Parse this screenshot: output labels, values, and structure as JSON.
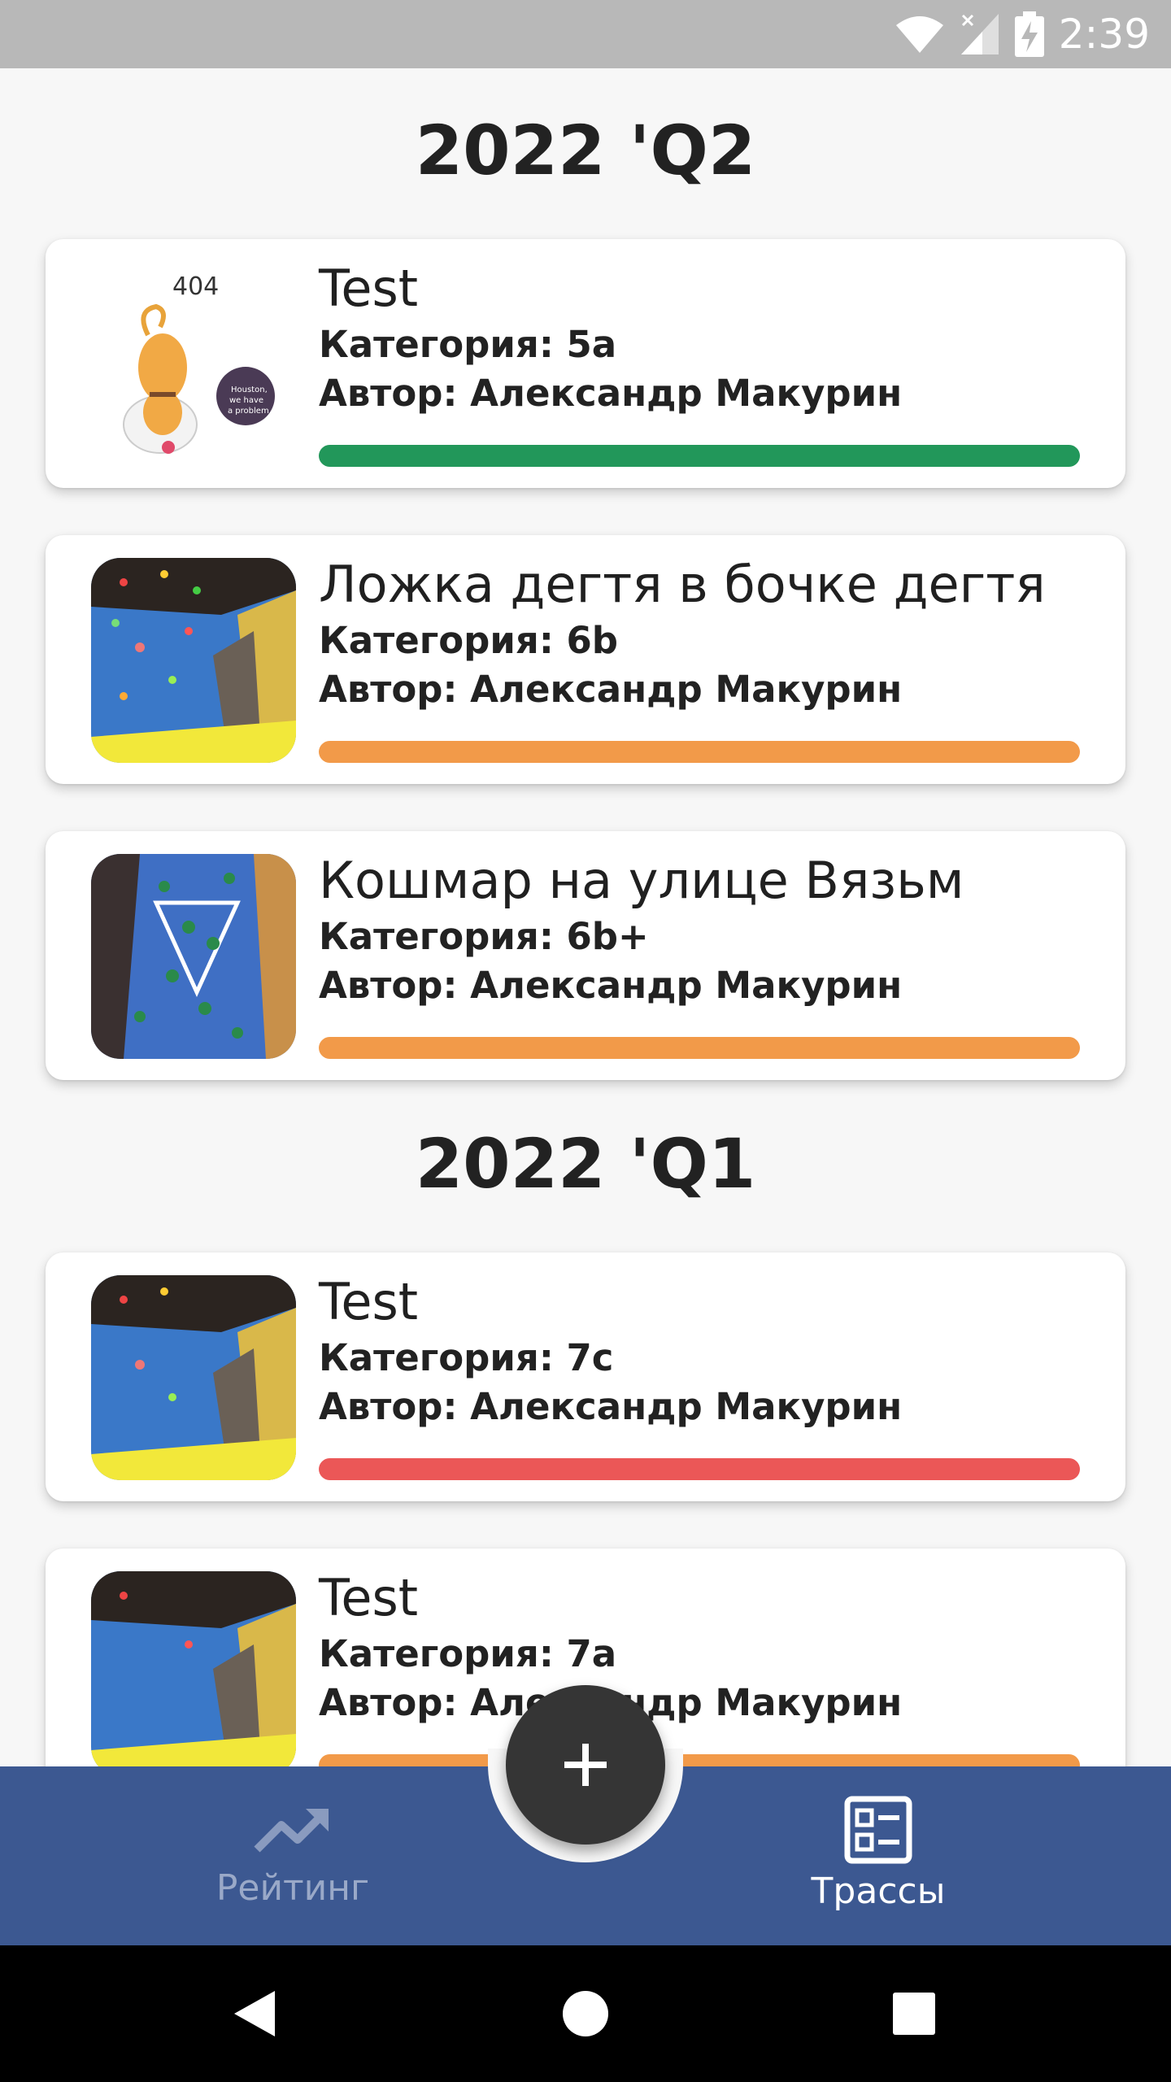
{
  "status_bar": {
    "time": "2:39"
  },
  "sections": [
    {
      "title": "2022 'Q2",
      "routes": [
        {
          "name": "Test",
          "category": "Категория: 5a",
          "author": "Автор: Александр Макурин",
          "bar_color": "#22975a",
          "image": "404-cat-icon"
        },
        {
          "name": "Ложка дегтя в бочке дегтя",
          "category": "Категория: 6b",
          "author": "Автор: Александр Макурин",
          "bar_color": "#f29a49",
          "image": "climbing-wall-photo"
        },
        {
          "name": "Кошмар на улице Вязьм",
          "category": "Категория: 6b+",
          "author": "Автор: Александр Макурин",
          "bar_color": "#f29a49",
          "image": "climbing-wall-photo"
        }
      ]
    },
    {
      "title": "2022 'Q1",
      "routes": [
        {
          "name": "Test",
          "category": "Категория: 7c",
          "author": "Автор: Александр Макурин",
          "bar_color": "#eb5757",
          "image": "climbing-wall-photo"
        },
        {
          "name": "Test",
          "category": "Категория: 7a",
          "author": "Автор: Александр Макурин",
          "bar_color": "#f29a49",
          "image": "climbing-wall-photo"
        }
      ]
    }
  ],
  "placeholder_404": {
    "code": "404",
    "bubble": "Houston, we have a problem"
  },
  "bottom_nav": {
    "items": [
      {
        "label": "Рейтинг",
        "icon": "trending-up-icon",
        "active": false
      },
      {
        "label": "Трассы",
        "icon": "routes-list-icon",
        "active": true
      }
    ],
    "fab_icon": "plus-icon"
  },
  "colors": {
    "nav_bg": "#3c5891",
    "fab_bg": "#353535",
    "green": "#22975a",
    "orange": "#f29a49",
    "red": "#eb5757"
  }
}
